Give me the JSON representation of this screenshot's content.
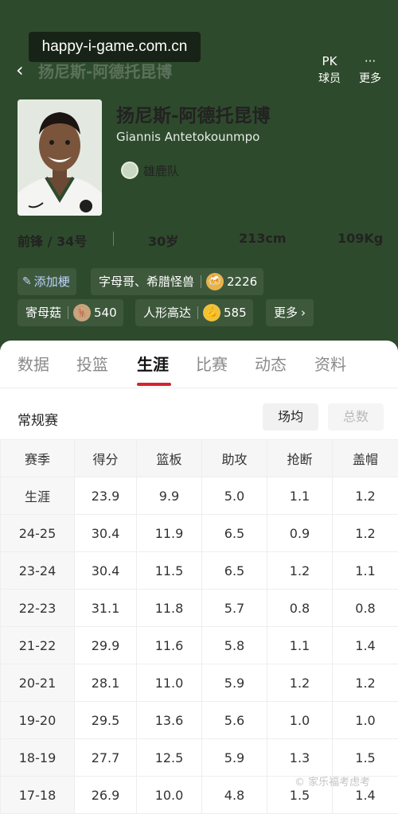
{
  "watermark": "happy-i-game.com.cn",
  "topbar": {
    "title": "扬尼斯-阿德托昆博",
    "compare_icon": "PK",
    "compare_label": "球员",
    "more_icon": "···",
    "more_label": "更多"
  },
  "player": {
    "name_cn": "扬尼斯-阿德托昆博",
    "name_en": "Giannis Antetokounmpo",
    "team": "雄鹿队",
    "position": "前锋 / 34号",
    "age": "30岁",
    "height": "213cm",
    "weight": "109Kg"
  },
  "tags": {
    "add_label": "添加梗",
    "nicknames": [
      {
        "label": "字母哥、希腊怪兽",
        "icon": "beer-icon",
        "count": "2226"
      },
      {
        "label": "寄母菇",
        "icon": "deer-icon",
        "count": "540"
      },
      {
        "label": "人形高达",
        "icon": "flexed-arm-icon",
        "count": "585"
      }
    ],
    "more_label": "更多",
    "more_arrow": "›"
  },
  "tabs": [
    "数据",
    "投篮",
    "生涯",
    "比赛",
    "动态",
    "资料"
  ],
  "active_tab": "生涯",
  "section": {
    "title": "常规赛",
    "toggle_on": "场均",
    "toggle_off": "总数"
  },
  "table": {
    "headers": [
      "赛季",
      "得分",
      "篮板",
      "助攻",
      "抢断",
      "盖帽"
    ],
    "rows": [
      [
        "生涯",
        "23.9",
        "9.9",
        "5.0",
        "1.1",
        "1.2"
      ],
      [
        "24-25",
        "30.4",
        "11.9",
        "6.5",
        "0.9",
        "1.2"
      ],
      [
        "23-24",
        "30.4",
        "11.5",
        "6.5",
        "1.2",
        "1.1"
      ],
      [
        "22-23",
        "31.1",
        "11.8",
        "5.7",
        "0.8",
        "0.8"
      ],
      [
        "21-22",
        "29.9",
        "11.6",
        "5.8",
        "1.1",
        "1.4"
      ],
      [
        "20-21",
        "28.1",
        "11.0",
        "5.9",
        "1.2",
        "1.2"
      ],
      [
        "19-20",
        "29.5",
        "13.6",
        "5.6",
        "1.0",
        "1.0"
      ],
      [
        "18-19",
        "27.7",
        "12.5",
        "5.9",
        "1.3",
        "1.5"
      ],
      [
        "17-18",
        "26.9",
        "10.0",
        "4.8",
        "1.5",
        "1.4"
      ]
    ]
  },
  "corner_watermark": "© 家乐福考虑考",
  "colors": {
    "header_bg": "#2e4a2c",
    "accent": "#d4242f"
  }
}
